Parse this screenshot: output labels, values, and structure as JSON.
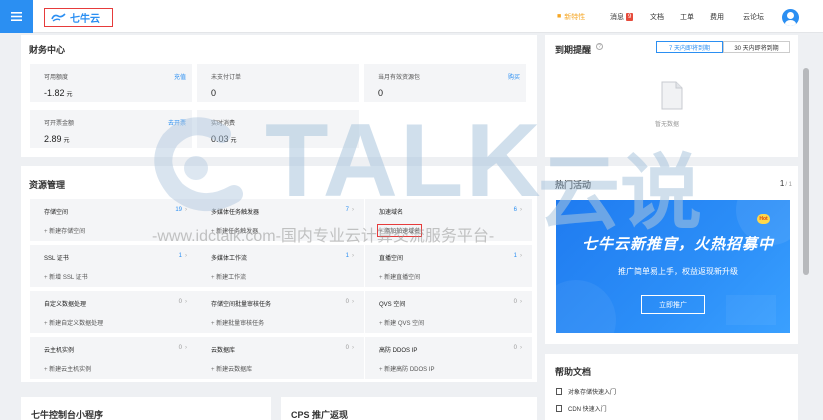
{
  "header": {
    "logo_text": "七牛云",
    "nav": [
      {
        "label": "新特性"
      },
      {
        "label": "消息",
        "badge": "9"
      },
      {
        "label": "文档"
      },
      {
        "label": "工单"
      },
      {
        "label": "费用"
      },
      {
        "label": "云论坛"
      }
    ]
  },
  "finance": {
    "title": "财务中心",
    "cards": [
      {
        "label": "可用额度",
        "link": "充值",
        "value": "-1.82",
        "unit": "元"
      },
      {
        "label": "未支付订单",
        "link": "",
        "value": "0",
        "unit": ""
      },
      {
        "label": "当月有效资源包",
        "link": "购买",
        "value": "0",
        "unit": ""
      },
      {
        "label": "可开票金额",
        "link": "去开票",
        "value": "2.89",
        "unit": "元"
      },
      {
        "label": "实时消费",
        "link": "",
        "value": "0.03",
        "unit": "元"
      }
    ]
  },
  "expiry": {
    "title": "到期提醒",
    "help_icon": "?",
    "tabs": [
      "7 天内即将到期",
      "30 天内即将到期"
    ],
    "empty_text": "暂无数据"
  },
  "resources": {
    "title": "资源管理",
    "items": [
      {
        "name": "存储空间",
        "count": "19",
        "add": "新建存储空间"
      },
      {
        "name": "多媒体任务触发器",
        "count": "7",
        "add": "新建任务触发器"
      },
      {
        "name": "加速域名",
        "count": "6",
        "add": "添加加速域名"
      },
      {
        "name": "SSL 证书",
        "count": "1",
        "add": "新增 SSL 证书"
      },
      {
        "name": "多媒体工作流",
        "count": "1",
        "add": "新建工作流"
      },
      {
        "name": "直播空间",
        "count": "1",
        "add": "新建直播空间"
      },
      {
        "name": "自定义数据处理",
        "count": "0",
        "add": "新建自定义数据处理"
      },
      {
        "name": "存储空间批量审核任务",
        "count": "0",
        "add": "新建批量审核任务"
      },
      {
        "name": "QVS 空间",
        "count": "0",
        "add": "新建 QVS 空间"
      },
      {
        "name": "云主机实例",
        "count": "0",
        "add": "新建云主机实例"
      },
      {
        "name": "云数据库",
        "count": "0",
        "add": "新建云数据库"
      },
      {
        "name": "高防 DDOS IP",
        "count": "0",
        "add": "新建高防 DDOS IP"
      }
    ]
  },
  "hot": {
    "title": "热门活动",
    "pager": "1",
    "pager_total": "/ 1",
    "banner_title": "七牛云新推官，火热招募中",
    "banner_sub": "推广简单易上手，权益返现新升级",
    "banner_button": "立即推广",
    "banner_badge": "Hot"
  },
  "help_docs": {
    "title": "帮助文档",
    "items": [
      "对象存储快速入门",
      "CDN 快速入门"
    ]
  },
  "bottom_panels": [
    "七牛控制台小程序",
    "CPS 推广返现"
  ],
  "watermark": {
    "big": "TALK",
    "big_cn": "云说",
    "line": "-www.idctalk.com-国内专业云计算交流服务平台-"
  },
  "colors": {
    "accent": "#2b8ff2",
    "highlight_box": "#e63b3b",
    "nav_dot": "#f5a623"
  }
}
